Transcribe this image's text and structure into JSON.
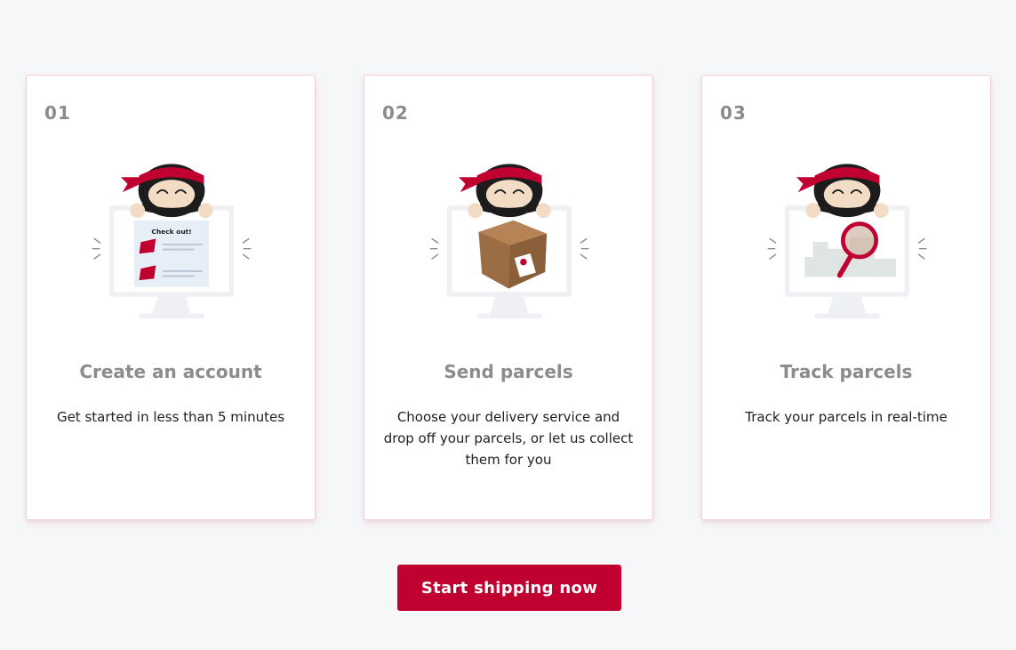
{
  "colors": {
    "accent": "#c0002f",
    "background": "#f6f7f9",
    "number": "#8a8c8e",
    "card_border": "#f3cfd4"
  },
  "steps": [
    {
      "number": "01",
      "title": "Create an account",
      "description": "Get started in less than 5 minutes",
      "illustration": "ninja-checkout-icon",
      "screen_text": "Check out!"
    },
    {
      "number": "02",
      "title": "Send parcels",
      "description": "Choose your delivery service and drop off your parcels, or let us collect them for you",
      "illustration": "ninja-parcel-icon"
    },
    {
      "number": "03",
      "title": "Track parcels",
      "description": "Track your parcels in real-time",
      "illustration": "ninja-magnifier-icon"
    }
  ],
  "cta": {
    "label": "Start shipping now"
  }
}
